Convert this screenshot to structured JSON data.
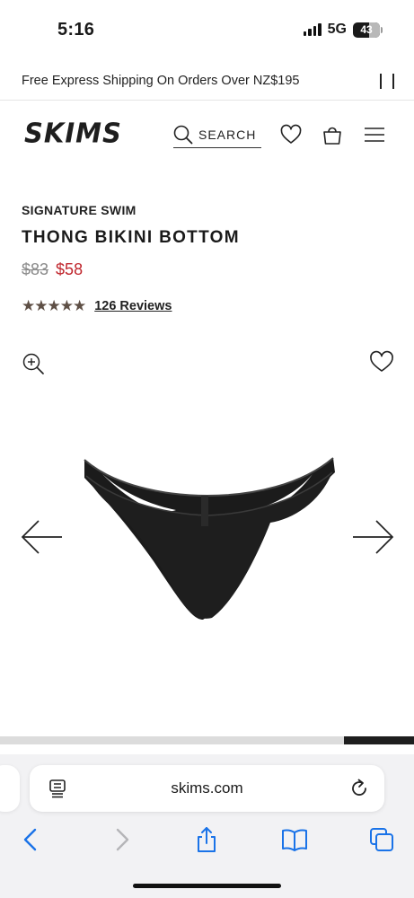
{
  "status_bar": {
    "time": "5:16",
    "network": "5G",
    "battery": "43"
  },
  "promo": {
    "text": "Free Express Shipping On Orders Over NZ$195"
  },
  "header": {
    "logo": "SKIMS",
    "search_label": "SEARCH"
  },
  "product": {
    "collection": "SIGNATURE SWIM",
    "title": "THONG BIKINI BOTTOM",
    "price_original": "$83",
    "price_sale": "$58",
    "rating": 5,
    "stars": "★★★★★",
    "reviews_label": "126 Reviews"
  },
  "gallery": {
    "progress_fraction": 0.17,
    "progress_position": "end"
  },
  "browser": {
    "url": "skims.com"
  },
  "colors": {
    "sale_price": "#c0262d",
    "stars": "#5e4f45",
    "accent_ios": "#1a73e8"
  },
  "icons": [
    "search-icon",
    "heart-icon",
    "bag-icon",
    "menu-icon",
    "zoom-in-icon",
    "wishlist-heart-icon",
    "arrow-left-icon",
    "arrow-right-icon",
    "reader-icon",
    "reload-icon",
    "back-icon",
    "forward-icon",
    "share-icon",
    "bookmarks-icon",
    "tabs-icon"
  ]
}
